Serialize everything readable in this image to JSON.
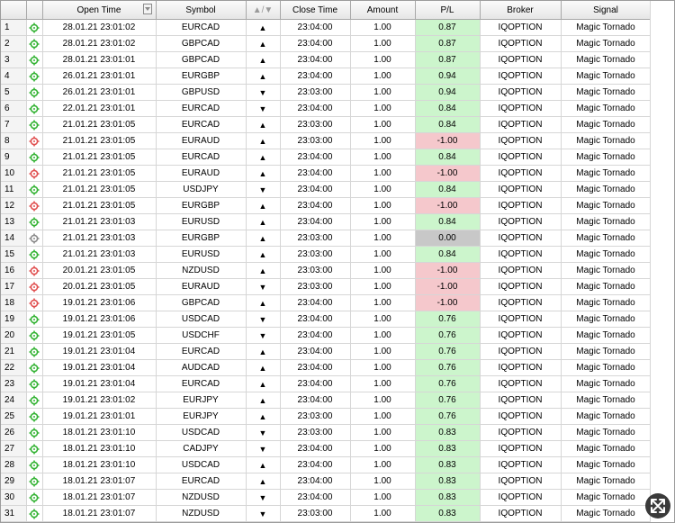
{
  "columns": {
    "open_time": "Open Time",
    "symbol": "Symbol",
    "direction": "▲/▼",
    "close_time": "Close Time",
    "amount": "Amount",
    "pl": "P/L",
    "broker": "Broker",
    "signal": "Signal"
  },
  "icons": {
    "win": "green-target-icon",
    "loss": "red-target-icon",
    "draw": "gray-target-icon",
    "up": "▲",
    "down": "▼",
    "resize": "resize-arrows-icon"
  },
  "colors": {
    "pl_positive": "#ccf5cc",
    "pl_negative": "#f5c8cc",
    "pl_zero": "#c8c8c8",
    "icon_win": "#34b334",
    "icon_loss": "#e05050",
    "icon_draw": "#8a8a8a"
  },
  "rows": [
    {
      "n": "1",
      "status": "win",
      "open_time": "28.01.21 23:01:02",
      "symbol": "EURCAD",
      "dir": "▲",
      "close_time": "23:04:00",
      "amount": "1.00",
      "pl": "0.87",
      "broker": "IQOPTION",
      "signal": "Magic Tornado"
    },
    {
      "n": "2",
      "status": "win",
      "open_time": "28.01.21 23:01:02",
      "symbol": "GBPCAD",
      "dir": "▲",
      "close_time": "23:04:00",
      "amount": "1.00",
      "pl": "0.87",
      "broker": "IQOPTION",
      "signal": "Magic Tornado"
    },
    {
      "n": "3",
      "status": "win",
      "open_time": "28.01.21 23:01:01",
      "symbol": "GBPCAD",
      "dir": "▲",
      "close_time": "23:04:00",
      "amount": "1.00",
      "pl": "0.87",
      "broker": "IQOPTION",
      "signal": "Magic Tornado"
    },
    {
      "n": "4",
      "status": "win",
      "open_time": "26.01.21 23:01:01",
      "symbol": "EURGBP",
      "dir": "▲",
      "close_time": "23:04:00",
      "amount": "1.00",
      "pl": "0.94",
      "broker": "IQOPTION",
      "signal": "Magic Tornado"
    },
    {
      "n": "5",
      "status": "win",
      "open_time": "26.01.21 23:01:01",
      "symbol": "GBPUSD",
      "dir": "▼",
      "close_time": "23:03:00",
      "amount": "1.00",
      "pl": "0.94",
      "broker": "IQOPTION",
      "signal": "Magic Tornado"
    },
    {
      "n": "6",
      "status": "win",
      "open_time": "22.01.21 23:01:01",
      "symbol": "EURCAD",
      "dir": "▼",
      "close_time": "23:04:00",
      "amount": "1.00",
      "pl": "0.84",
      "broker": "IQOPTION",
      "signal": "Magic Tornado"
    },
    {
      "n": "7",
      "status": "win",
      "open_time": "21.01.21 23:01:05",
      "symbol": "EURCAD",
      "dir": "▲",
      "close_time": "23:03:00",
      "amount": "1.00",
      "pl": "0.84",
      "broker": "IQOPTION",
      "signal": "Magic Tornado"
    },
    {
      "n": "8",
      "status": "loss",
      "open_time": "21.01.21 23:01:05",
      "symbol": "EURAUD",
      "dir": "▲",
      "close_time": "23:03:00",
      "amount": "1.00",
      "pl": "-1.00",
      "broker": "IQOPTION",
      "signal": "Magic Tornado"
    },
    {
      "n": "9",
      "status": "win",
      "open_time": "21.01.21 23:01:05",
      "symbol": "EURCAD",
      "dir": "▲",
      "close_time": "23:04:00",
      "amount": "1.00",
      "pl": "0.84",
      "broker": "IQOPTION",
      "signal": "Magic Tornado"
    },
    {
      "n": "10",
      "status": "loss",
      "open_time": "21.01.21 23:01:05",
      "symbol": "EURAUD",
      "dir": "▲",
      "close_time": "23:04:00",
      "amount": "1.00",
      "pl": "-1.00",
      "broker": "IQOPTION",
      "signal": "Magic Tornado"
    },
    {
      "n": "11",
      "status": "win",
      "open_time": "21.01.21 23:01:05",
      "symbol": "USDJPY",
      "dir": "▼",
      "close_time": "23:04:00",
      "amount": "1.00",
      "pl": "0.84",
      "broker": "IQOPTION",
      "signal": "Magic Tornado"
    },
    {
      "n": "12",
      "status": "loss",
      "open_time": "21.01.21 23:01:05",
      "symbol": "EURGBP",
      "dir": "▲",
      "close_time": "23:04:00",
      "amount": "1.00",
      "pl": "-1.00",
      "broker": "IQOPTION",
      "signal": "Magic Tornado"
    },
    {
      "n": "13",
      "status": "win",
      "open_time": "21.01.21 23:01:03",
      "symbol": "EURUSD",
      "dir": "▲",
      "close_time": "23:04:00",
      "amount": "1.00",
      "pl": "0.84",
      "broker": "IQOPTION",
      "signal": "Magic Tornado"
    },
    {
      "n": "14",
      "status": "draw",
      "open_time": "21.01.21 23:01:03",
      "symbol": "EURGBP",
      "dir": "▲",
      "close_time": "23:03:00",
      "amount": "1.00",
      "pl": "0.00",
      "broker": "IQOPTION",
      "signal": "Magic Tornado"
    },
    {
      "n": "15",
      "status": "win",
      "open_time": "21.01.21 23:01:03",
      "symbol": "EURUSD",
      "dir": "▲",
      "close_time": "23:03:00",
      "amount": "1.00",
      "pl": "0.84",
      "broker": "IQOPTION",
      "signal": "Magic Tornado"
    },
    {
      "n": "16",
      "status": "loss",
      "open_time": "20.01.21 23:01:05",
      "symbol": "NZDUSD",
      "dir": "▲",
      "close_time": "23:03:00",
      "amount": "1.00",
      "pl": "-1.00",
      "broker": "IQOPTION",
      "signal": "Magic Tornado"
    },
    {
      "n": "17",
      "status": "loss",
      "open_time": "20.01.21 23:01:05",
      "symbol": "EURAUD",
      "dir": "▼",
      "close_time": "23:03:00",
      "amount": "1.00",
      "pl": "-1.00",
      "broker": "IQOPTION",
      "signal": "Magic Tornado"
    },
    {
      "n": "18",
      "status": "loss",
      "open_time": "19.01.21 23:01:06",
      "symbol": "GBPCAD",
      "dir": "▲",
      "close_time": "23:04:00",
      "amount": "1.00",
      "pl": "-1.00",
      "broker": "IQOPTION",
      "signal": "Magic Tornado"
    },
    {
      "n": "19",
      "status": "win",
      "open_time": "19.01.21 23:01:06",
      "symbol": "USDCAD",
      "dir": "▼",
      "close_time": "23:04:00",
      "amount": "1.00",
      "pl": "0.76",
      "broker": "IQOPTION",
      "signal": "Magic Tornado"
    },
    {
      "n": "20",
      "status": "win",
      "open_time": "19.01.21 23:01:05",
      "symbol": "USDCHF",
      "dir": "▼",
      "close_time": "23:04:00",
      "amount": "1.00",
      "pl": "0.76",
      "broker": "IQOPTION",
      "signal": "Magic Tornado"
    },
    {
      "n": "21",
      "status": "win",
      "open_time": "19.01.21 23:01:04",
      "symbol": "EURCAD",
      "dir": "▲",
      "close_time": "23:04:00",
      "amount": "1.00",
      "pl": "0.76",
      "broker": "IQOPTION",
      "signal": "Magic Tornado"
    },
    {
      "n": "22",
      "status": "win",
      "open_time": "19.01.21 23:01:04",
      "symbol": "AUDCAD",
      "dir": "▲",
      "close_time": "23:04:00",
      "amount": "1.00",
      "pl": "0.76",
      "broker": "IQOPTION",
      "signal": "Magic Tornado"
    },
    {
      "n": "23",
      "status": "win",
      "open_time": "19.01.21 23:01:04",
      "symbol": "EURCAD",
      "dir": "▲",
      "close_time": "23:04:00",
      "amount": "1.00",
      "pl": "0.76",
      "broker": "IQOPTION",
      "signal": "Magic Tornado"
    },
    {
      "n": "24",
      "status": "win",
      "open_time": "19.01.21 23:01:02",
      "symbol": "EURJPY",
      "dir": "▲",
      "close_time": "23:04:00",
      "amount": "1.00",
      "pl": "0.76",
      "broker": "IQOPTION",
      "signal": "Magic Tornado"
    },
    {
      "n": "25",
      "status": "win",
      "open_time": "19.01.21 23:01:01",
      "symbol": "EURJPY",
      "dir": "▲",
      "close_time": "23:03:00",
      "amount": "1.00",
      "pl": "0.76",
      "broker": "IQOPTION",
      "signal": "Magic Tornado"
    },
    {
      "n": "26",
      "status": "win",
      "open_time": "18.01.21 23:01:10",
      "symbol": "USDCAD",
      "dir": "▼",
      "close_time": "23:03:00",
      "amount": "1.00",
      "pl": "0.83",
      "broker": "IQOPTION",
      "signal": "Magic Tornado"
    },
    {
      "n": "27",
      "status": "win",
      "open_time": "18.01.21 23:01:10",
      "symbol": "CADJPY",
      "dir": "▼",
      "close_time": "23:04:00",
      "amount": "1.00",
      "pl": "0.83",
      "broker": "IQOPTION",
      "signal": "Magic Tornado"
    },
    {
      "n": "28",
      "status": "win",
      "open_time": "18.01.21 23:01:10",
      "symbol": "USDCAD",
      "dir": "▲",
      "close_time": "23:04:00",
      "amount": "1.00",
      "pl": "0.83",
      "broker": "IQOPTION",
      "signal": "Magic Tornado"
    },
    {
      "n": "29",
      "status": "win",
      "open_time": "18.01.21 23:01:07",
      "symbol": "EURCAD",
      "dir": "▲",
      "close_time": "23:04:00",
      "amount": "1.00",
      "pl": "0.83",
      "broker": "IQOPTION",
      "signal": "Magic Tornado"
    },
    {
      "n": "30",
      "status": "win",
      "open_time": "18.01.21 23:01:07",
      "symbol": "NZDUSD",
      "dir": "▼",
      "close_time": "23:04:00",
      "amount": "1.00",
      "pl": "0.83",
      "broker": "IQOPTION",
      "signal": "Magic Tornado"
    },
    {
      "n": "31",
      "status": "win",
      "open_time": "18.01.21 23:01:07",
      "symbol": "NZDUSD",
      "dir": "▼",
      "close_time": "23:03:00",
      "amount": "1.00",
      "pl": "0.83",
      "broker": "IQOPTION",
      "signal": "Magic Tornado"
    }
  ]
}
